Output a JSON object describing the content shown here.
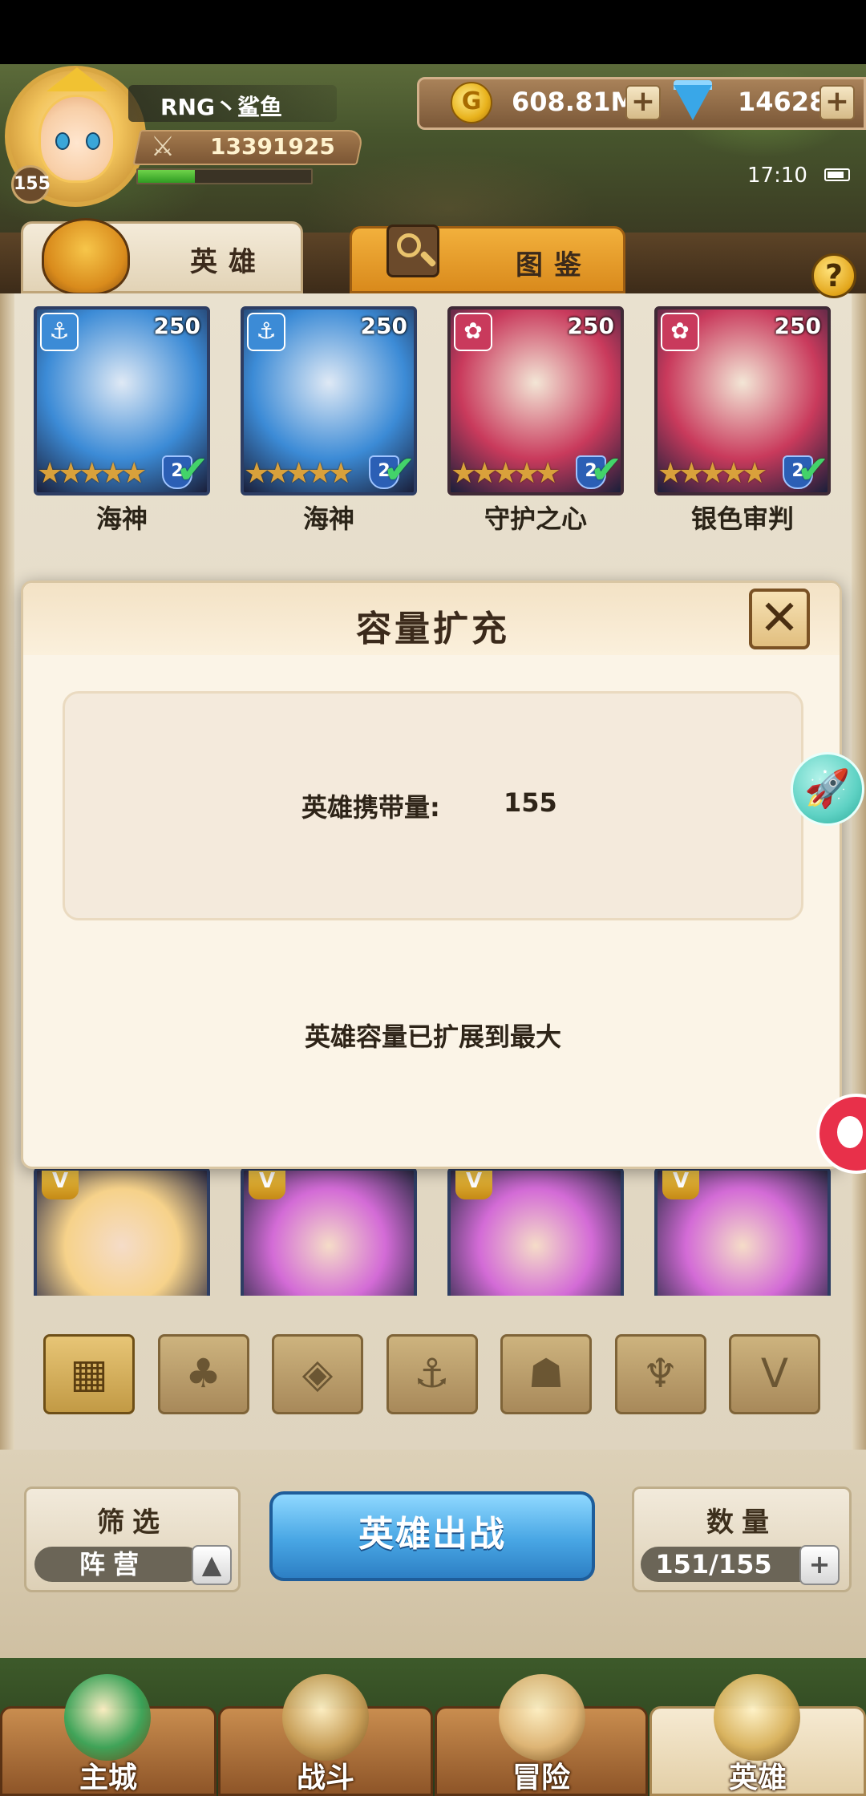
{
  "player": {
    "name": "RNG丶鲨鱼",
    "level": "155",
    "power": "13391925",
    "exp_fraction": 0.33
  },
  "currency": {
    "gold_symbol": "G",
    "gold": "608.81M",
    "gems": "14628",
    "plus": "+"
  },
  "status": {
    "time": "17:10"
  },
  "tabs": {
    "heroes": "英雄",
    "gallery": "图鉴",
    "help": "?"
  },
  "hero_cards": [
    {
      "name": "海神",
      "level": "250",
      "faction": "anchor",
      "faction_symbol": "⚓",
      "stars": "★★★★★",
      "rank": "2",
      "accent": "#3c8bd6"
    },
    {
      "name": "海神",
      "level": "250",
      "faction": "anchor",
      "faction_symbol": "⚓",
      "stars": "★★★★★",
      "rank": "2",
      "accent": "#3c8bd6"
    },
    {
      "name": "守护之心",
      "level": "250",
      "faction": "leaf",
      "faction_symbol": "✿",
      "stars": "★★★★★",
      "rank": "2",
      "accent": "#c93a5c"
    },
    {
      "name": "银色审判",
      "level": "250",
      "faction": "leaf",
      "faction_symbol": "✿",
      "stars": "★★★★★",
      "rank": "2",
      "accent": "#c93a5c"
    }
  ],
  "partial_cards": [
    {
      "badge": "V",
      "color": "#f6d28a"
    },
    {
      "badge": "V",
      "color": "#d36bd6"
    },
    {
      "badge": "V",
      "color": "#d36bd6"
    },
    {
      "badge": "V",
      "color": "#d36bd6"
    }
  ],
  "modal": {
    "title": "容量扩充",
    "close_symbol": "✕",
    "capacity_label": "英雄携带量:",
    "capacity_value": "155",
    "max_message": "英雄容量已扩展到最大"
  },
  "filters": [
    {
      "icon": "grid-icon",
      "symbol": "▦",
      "active": true
    },
    {
      "icon": "leaf-icon",
      "symbol": "♣",
      "active": false
    },
    {
      "icon": "diamond-icon",
      "symbol": "◈",
      "active": false
    },
    {
      "icon": "anchor-icon",
      "symbol": "⚓",
      "active": false
    },
    {
      "icon": "beast-icon",
      "symbol": "☗",
      "active": false
    },
    {
      "icon": "demon-icon",
      "symbol": "♆",
      "active": false
    },
    {
      "icon": "wing-icon",
      "symbol": "V",
      "active": false
    }
  ],
  "controls": {
    "filter_title": "筛选",
    "filter_value": "阵营",
    "filter_arrow": "▲",
    "deploy_label": "英雄出战",
    "count_title": "数量",
    "count_value": "151/155",
    "count_plus": "+"
  },
  "nav": [
    {
      "label": "主城",
      "icon": "castle-icon",
      "active": false
    },
    {
      "label": "战斗",
      "icon": "crossed-swords-icon",
      "active": false
    },
    {
      "label": "冒险",
      "icon": "scroll-icon",
      "active": false
    },
    {
      "label": "英雄",
      "icon": "hero-helmet-icon",
      "active": true
    }
  ],
  "colors": {
    "gold": "#e8b21c",
    "gem": "#39a7e8",
    "deploy": "#48a6e4",
    "parchment": "#e9e1cf"
  }
}
